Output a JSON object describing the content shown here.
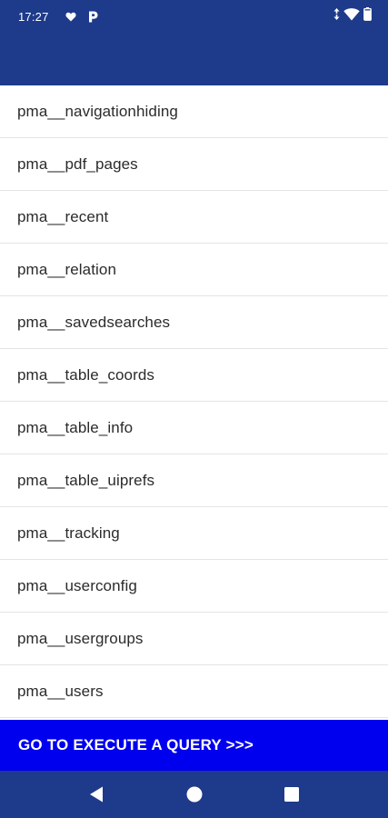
{
  "status_bar": {
    "time": "17:27",
    "left_icons": [
      "heart-icon",
      "parking-icon"
    ],
    "right_icons": [
      "data-arrows-icon",
      "wifi-icon",
      "battery-icon"
    ]
  },
  "tables": [
    "pma__navigationhiding",
    "pma__pdf_pages",
    "pma__recent",
    "pma__relation",
    "pma__savedsearches",
    "pma__table_coords",
    "pma__table_info",
    "pma__table_uiprefs",
    "pma__tracking",
    "pma__userconfig",
    "pma__usergroups",
    "pma__users"
  ],
  "execute_button": {
    "label": "GO TO EXECUTE A QUERY >>>"
  },
  "nav_bar": {
    "buttons": [
      "back-icon",
      "home-icon",
      "recents-icon"
    ]
  },
  "colors": {
    "primary": "#1e3a8a",
    "accent": "#0000ee",
    "text": "#2b2b2b",
    "divider": "#e4e4e4"
  }
}
